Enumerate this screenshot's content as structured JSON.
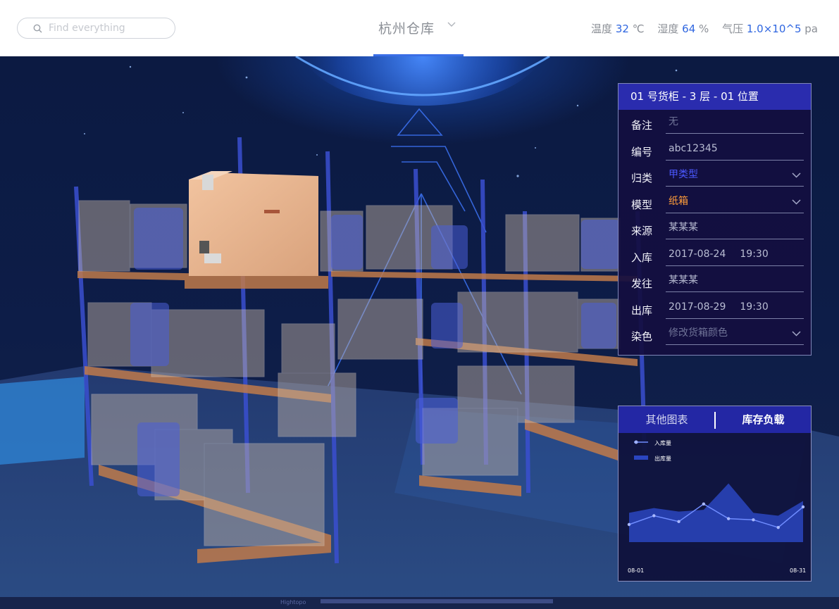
{
  "search": {
    "placeholder": "Find everything",
    "icon": "search-icon"
  },
  "location": {
    "name": "杭州仓库"
  },
  "env": {
    "temp_label": "温度",
    "temp_value": "32",
    "temp_unit": "℃",
    "hum_label": "湿度",
    "hum_value": "64",
    "hum_unit": "%",
    "press_label": "气压",
    "press_value": "1.0×10^5",
    "press_unit": "pa",
    "accent": "#2f66e0"
  },
  "scene": {
    "watermark": "Hightopo"
  },
  "info": {
    "title": "01 号货柜 - 3 层 - 01 位置",
    "rows": [
      {
        "label": "备注",
        "value": "无"
      },
      {
        "label": "编号",
        "value": "abc12345"
      },
      {
        "label": "归类",
        "value": "甲类型"
      },
      {
        "label": "模型",
        "value": "纸箱"
      },
      {
        "label": "来源",
        "value": "某某某"
      },
      {
        "label": "入库",
        "date": "2017-08-24",
        "time": "19:30"
      },
      {
        "label": "发往",
        "value": "某某某"
      },
      {
        "label": "出库",
        "date": "2017-08-29",
        "time": "19:30"
      },
      {
        "label": "染色",
        "value": "修改货箱颜色"
      }
    ]
  },
  "chart_panel": {
    "tab_other": "其他图表",
    "tab_active": "库存负载"
  },
  "chart_data": {
    "type": "line",
    "x_tick_labels": [
      "08-01",
      "08-31"
    ],
    "series": [
      {
        "name": "入库量",
        "kind": "line",
        "color": "#6f8cff",
        "values": [
          3,
          4.5,
          3.5,
          6.5,
          4,
          3.8,
          2.5,
          6
        ]
      },
      {
        "name": "出库量",
        "kind": "area",
        "color": "#2a45c0",
        "values": [
          5,
          5.8,
          5.2,
          5.5,
          10,
          5,
          4.5,
          7
        ]
      }
    ],
    "ylim": [
      0,
      12
    ]
  }
}
